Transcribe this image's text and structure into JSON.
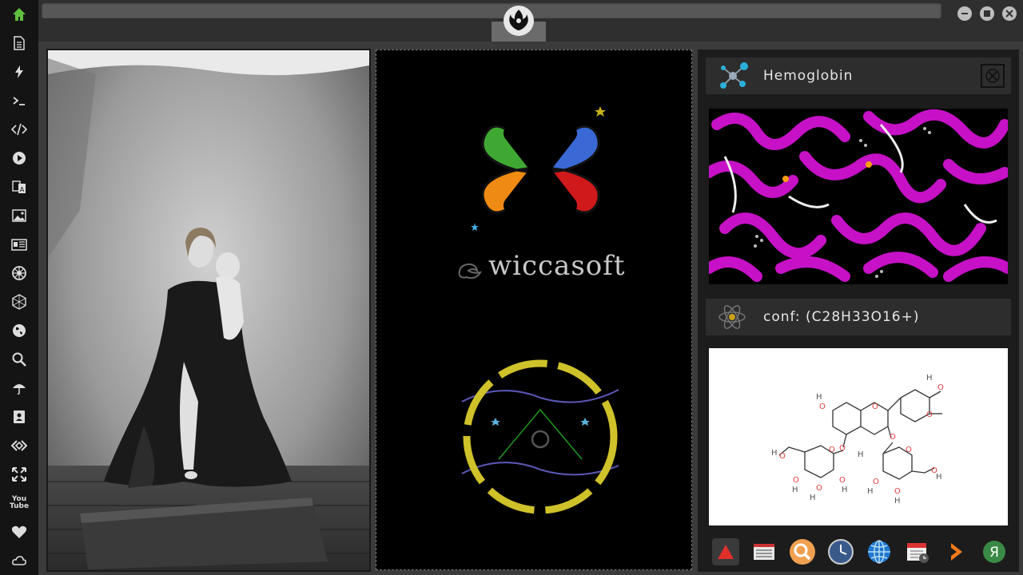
{
  "sidebar": {
    "items": [
      {
        "icon": "home-icon"
      },
      {
        "icon": "document-icon"
      },
      {
        "icon": "lightning-icon"
      },
      {
        "icon": "terminal-icon"
      },
      {
        "icon": "code-icon"
      },
      {
        "icon": "play-icon"
      },
      {
        "icon": "translate-icon"
      },
      {
        "icon": "image-icon"
      },
      {
        "icon": "news-icon"
      },
      {
        "icon": "empire-icon"
      },
      {
        "icon": "hexagon-icon"
      },
      {
        "icon": "globe-icon"
      },
      {
        "icon": "search-icon"
      },
      {
        "icon": "umbrella-icon"
      },
      {
        "icon": "contact-icon"
      },
      {
        "icon": "share-icon"
      },
      {
        "icon": "fullscreen-icon"
      },
      {
        "icon": "youtube-icon"
      },
      {
        "icon": "heart-icon"
      },
      {
        "icon": "cloud-icon"
      }
    ],
    "youtube_label": "You Tube"
  },
  "center": {
    "brand": "wiccasoft"
  },
  "panel": {
    "protein_title": "Hemoglobin",
    "formula": "conf: (C28H33O16+)"
  },
  "molecule_labels": {
    "h": "H",
    "o": "O"
  },
  "colors": {
    "accent_green": "#5fbf3f",
    "magenta": "#d11ad1",
    "ring_yellow": "#cfc12a"
  }
}
